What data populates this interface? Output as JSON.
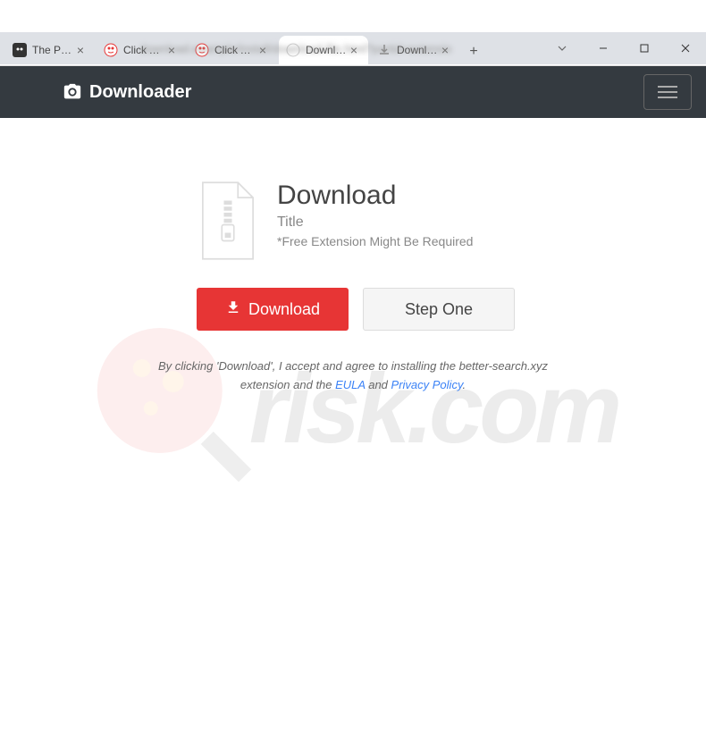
{
  "tabs": [
    {
      "title": "The Pirat",
      "active": false
    },
    {
      "title": "Click Allo",
      "active": false
    },
    {
      "title": "Click Allo",
      "active": false
    },
    {
      "title": "Downloa",
      "active": true
    },
    {
      "title": "Downloa",
      "active": false
    }
  ],
  "brand": {
    "name": "Downloader"
  },
  "download": {
    "heading": "Download",
    "subtitle": "Title",
    "note": "*Free Extension Might Be Required",
    "button_label": "Download",
    "step_label": "Step One"
  },
  "disclaimer": {
    "text_1": "By clicking 'Download', I accept and agree to installing the better-search.xyz extension and the ",
    "eula": "EULA",
    "and": " and ",
    "privacy": "Privacy Policy",
    "period": "."
  },
  "watermark": {
    "text": "risk.com"
  }
}
